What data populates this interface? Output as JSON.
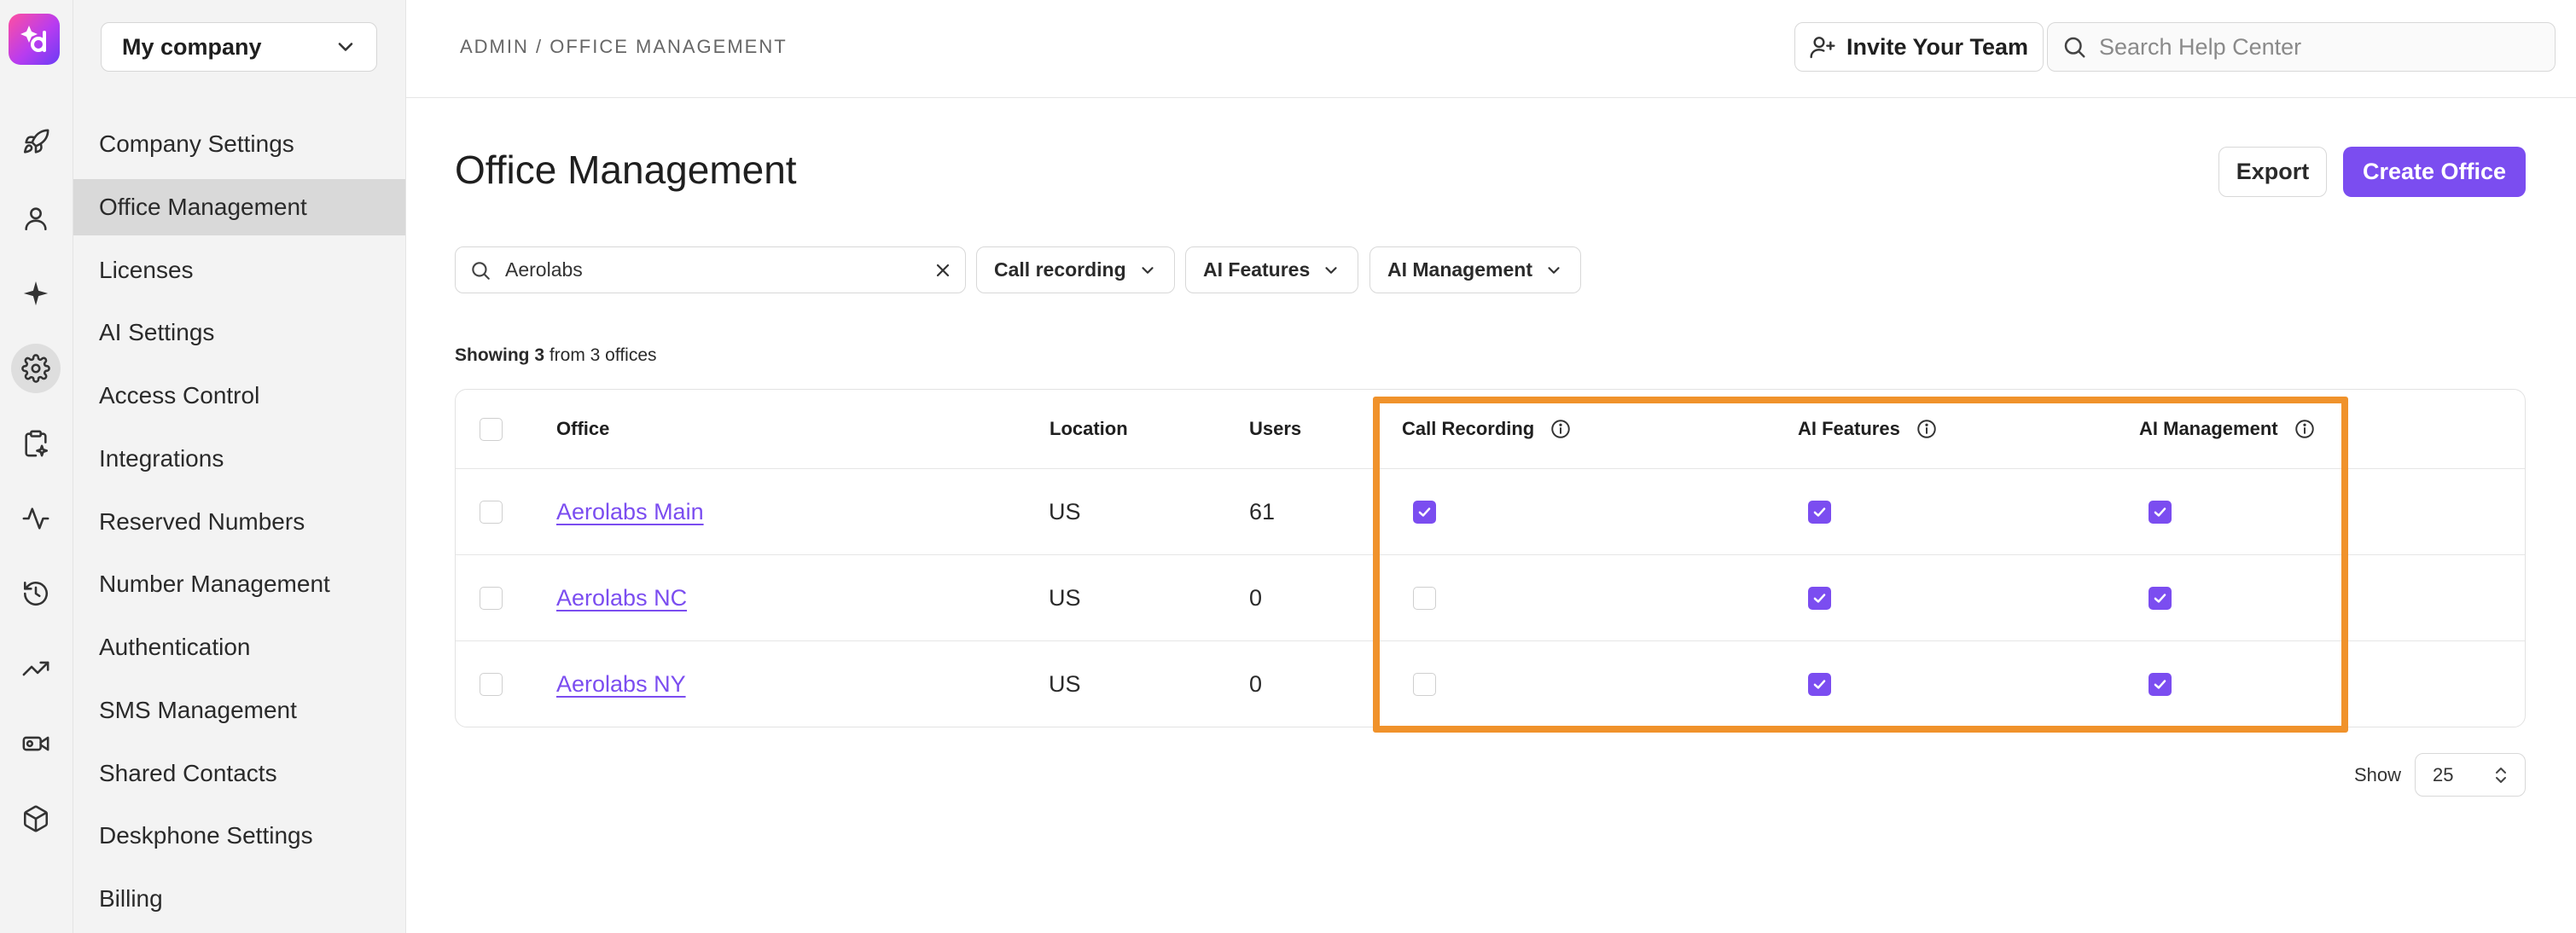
{
  "app": {
    "logo_icon": "dialpad-logo-icon",
    "rail_icons": [
      "rocket-icon",
      "person-icon",
      "sparkle-icon",
      "gear-icon",
      "clipboard-sparkle-icon",
      "activity-icon",
      "history-icon",
      "trending-up-icon",
      "video-camera-icon",
      "cube-icon"
    ],
    "active_rail_icon": "gear-icon"
  },
  "sidebar": {
    "company_select": "My company",
    "items": [
      {
        "label": "Company Settings"
      },
      {
        "label": "Office Management",
        "active": true
      },
      {
        "label": "Licenses"
      },
      {
        "label": "AI Settings"
      },
      {
        "label": "Access Control"
      },
      {
        "label": "Integrations"
      },
      {
        "label": "Reserved Numbers"
      },
      {
        "label": "Number Management"
      },
      {
        "label": "Authentication"
      },
      {
        "label": "SMS Management"
      },
      {
        "label": "Shared Contacts"
      },
      {
        "label": "Deskphone Settings"
      },
      {
        "label": "Billing"
      }
    ]
  },
  "topbar": {
    "breadcrumb": "ADMIN / OFFICE MANAGEMENT",
    "invite_label": "Invite Your Team",
    "help_search_placeholder": "Search Help Center"
  },
  "main": {
    "title": "Office Management",
    "export_label": "Export",
    "create_label": "Create Office",
    "search_value": "Aerolabs",
    "filters": [
      "Call recording",
      "AI Features",
      "AI Management"
    ],
    "showing_count": "Showing 3",
    "showing_rest": " from 3 offices",
    "table": {
      "columns": [
        "Office",
        "Location",
        "Users",
        "Call Recording",
        "AI Features",
        "AI Management"
      ],
      "rows": [
        {
          "office": "Aerolabs Main",
          "location": "US",
          "users": "61",
          "call_recording": true,
          "ai_features": true,
          "ai_management": true
        },
        {
          "office": "Aerolabs NC",
          "location": "US",
          "users": "0",
          "call_recording": false,
          "ai_features": true,
          "ai_management": true
        },
        {
          "office": "Aerolabs NY",
          "location": "US",
          "users": "0",
          "call_recording": false,
          "ai_features": true,
          "ai_management": true
        }
      ]
    },
    "show_label": "Show",
    "page_size": "25"
  },
  "colors": {
    "accent": "#7b4df0",
    "highlight": "#f0922b",
    "sidebar_bg": "#f3f3f3",
    "active_item_bg": "#d9d9d9"
  }
}
